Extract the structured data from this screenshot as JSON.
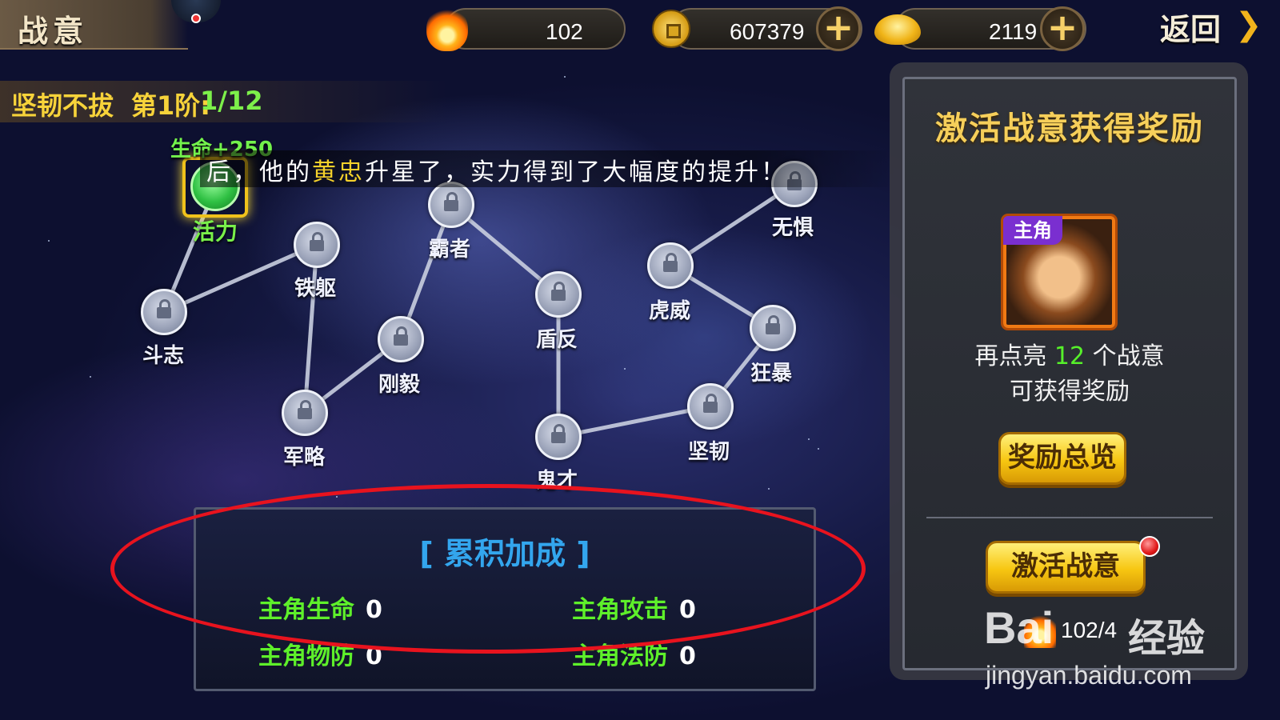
{
  "header": {
    "title": "战意",
    "stamina": "102",
    "coins": "607379",
    "ingots": "2119",
    "back_label": "返回",
    "plus": "+"
  },
  "progress": {
    "name": "坚韧不拔",
    "stage": "第1阶:",
    "count": "1/12"
  },
  "ticker": {
    "before": "后，他的",
    "highlight": "黄忠",
    "after": "升星了，实力得到了大幅度的提升！"
  },
  "map": {
    "active_node": {
      "label": "活力",
      "bonus": "生命+250"
    },
    "nodes": [
      {
        "label": "斗志"
      },
      {
        "label": "铁躯"
      },
      {
        "label": "军略"
      },
      {
        "label": "刚毅"
      },
      {
        "label": "霸者"
      },
      {
        "label": "盾反"
      },
      {
        "label": "鬼才"
      },
      {
        "label": "坚韧"
      },
      {
        "label": "狂暴"
      },
      {
        "label": "虎威"
      },
      {
        "label": "无惧"
      }
    ]
  },
  "accumulated": {
    "title": "[ 累积加成 ]",
    "stats": [
      {
        "key": "主角生命",
        "value": "0"
      },
      {
        "key": "主角攻击",
        "value": "0"
      },
      {
        "key": "主角物防",
        "value": "0"
      },
      {
        "key": "主角法防",
        "value": "0"
      }
    ]
  },
  "reward": {
    "title": "激活战意获得奖励",
    "portrait_tag": "主角",
    "hint_prefix": "再点亮",
    "hint_count": "12",
    "hint_suffix": "个战意",
    "hint_line2": "可获得奖励",
    "overview_button": "奖励总览",
    "activate_button": "激活战意",
    "cost": "102/4"
  },
  "watermark": {
    "brand": "Bai",
    "brand2": "经验",
    "url": "jingyan.baidu.com"
  },
  "colors": {
    "accent_gold": "#f6cf5a",
    "active_green": "#5ef02a",
    "panel_title_blue": "#33a6ee",
    "annotation_red": "#e8131e"
  }
}
